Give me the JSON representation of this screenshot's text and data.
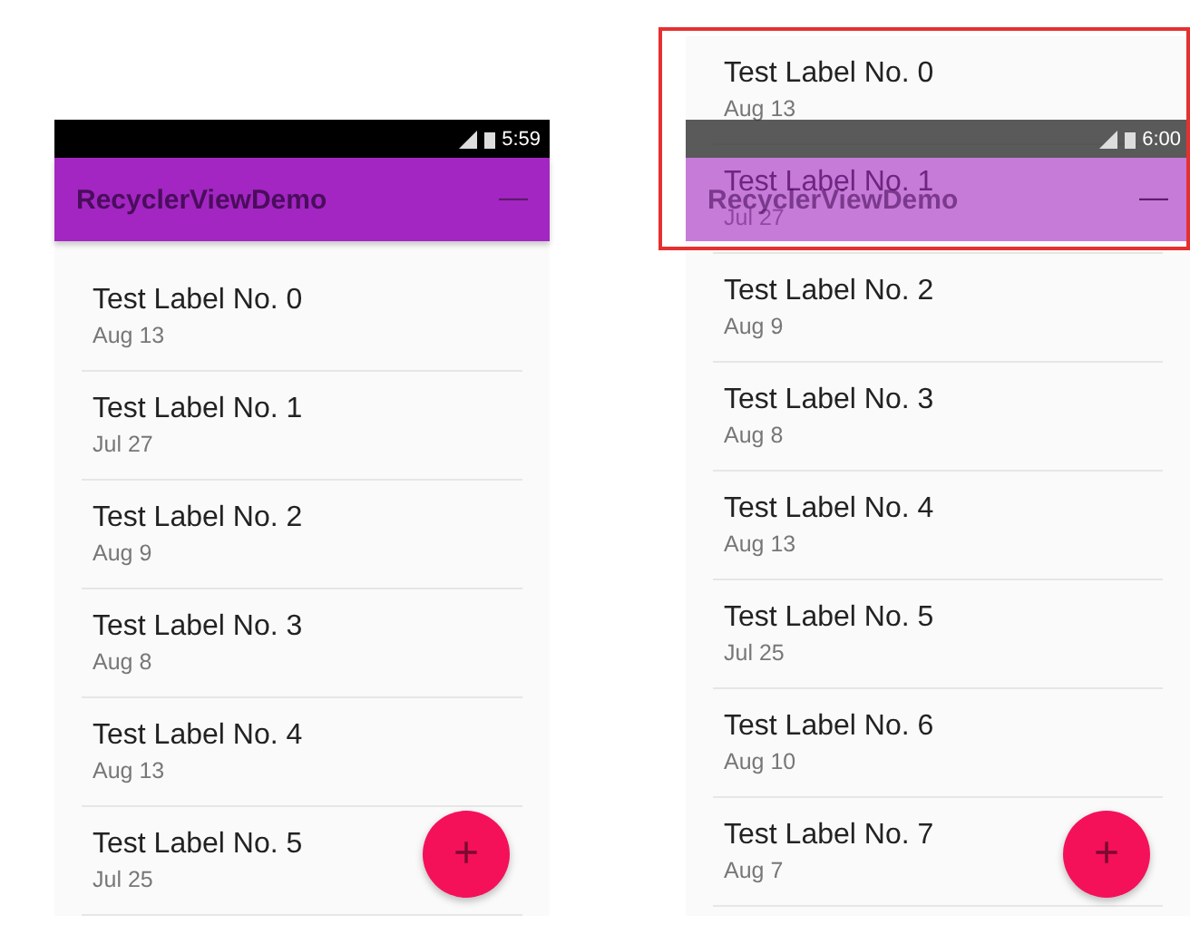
{
  "phones": [
    {
      "kind": "normal",
      "status_time": "5:59",
      "title": "RecyclerViewDemo",
      "menu": "—",
      "fab": "+",
      "items": [
        {
          "label": "Test Label No. 0",
          "date": "Aug 13"
        },
        {
          "label": "Test Label No. 1",
          "date": "Jul 27"
        },
        {
          "label": "Test Label No. 2",
          "date": "Aug 9"
        },
        {
          "label": "Test Label No. 3",
          "date": "Aug 8"
        },
        {
          "label": "Test Label No. 4",
          "date": "Aug 13"
        },
        {
          "label": "Test Label No. 5",
          "date": "Jul 25"
        }
      ]
    },
    {
      "kind": "overlay",
      "status_time": "6:00",
      "title": "RecyclerViewDemo",
      "menu": "—",
      "fab": "+",
      "items": [
        {
          "label": "Test Label No. 0",
          "date": "Aug 13"
        },
        {
          "label": "Test Label No. 1",
          "date": "Jul 27"
        },
        {
          "label": "Test Label No. 2",
          "date": "Aug 9"
        },
        {
          "label": "Test Label No. 3",
          "date": "Aug 8"
        },
        {
          "label": "Test Label No. 4",
          "date": "Aug 13"
        },
        {
          "label": "Test Label No. 5",
          "date": "Jul 25"
        },
        {
          "label": "Test Label No. 6",
          "date": "Aug 10"
        },
        {
          "label": "Test Label No. 7",
          "date": "Aug 7"
        }
      ]
    }
  ]
}
